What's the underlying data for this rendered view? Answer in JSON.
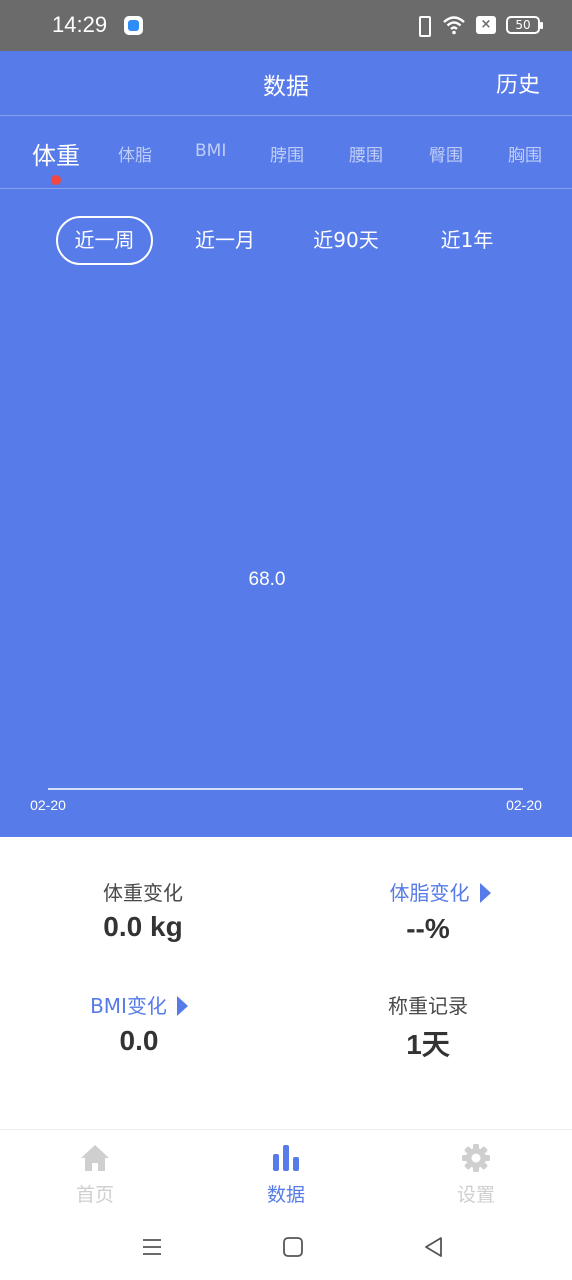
{
  "status_bar": {
    "time": "14:29",
    "battery": "50",
    "icons": [
      "app-icon",
      "vibrate-icon",
      "wifi-icon",
      "no-sim-icon",
      "battery-icon"
    ]
  },
  "header": {
    "title": "数据",
    "history_label": "历史"
  },
  "metric_tabs": [
    {
      "label": "体重",
      "active": true
    },
    {
      "label": "体脂",
      "active": false
    },
    {
      "label": "BMI",
      "active": false
    },
    {
      "label": "脖围",
      "active": false
    },
    {
      "label": "腰围",
      "active": false
    },
    {
      "label": "臀围",
      "active": false
    },
    {
      "label": "胸围",
      "active": false
    }
  ],
  "range_tabs": [
    {
      "label": "近一周",
      "active": true
    },
    {
      "label": "近一月",
      "active": false
    },
    {
      "label": "近90天",
      "active": false
    },
    {
      "label": "近1年",
      "active": false
    }
  ],
  "chart": {
    "point_value": "68.0",
    "x_start_label": "02-20",
    "x_end_label": "02-20"
  },
  "stats": {
    "weight_change": {
      "label": "体重变化",
      "value": "0.0 kg"
    },
    "fat_change": {
      "label": "体脂变化",
      "value": "--%"
    },
    "bmi_change": {
      "label": "BMI变化",
      "value": "0.0"
    },
    "weigh_record": {
      "label": "称重记录",
      "value": "1天"
    }
  },
  "bottom_nav": [
    {
      "label": "首页",
      "icon": "home-icon",
      "active": false
    },
    {
      "label": "数据",
      "icon": "bar-chart-icon",
      "active": true
    },
    {
      "label": "设置",
      "icon": "gear-icon",
      "active": false
    }
  ],
  "system_nav": [
    "menu-icon",
    "home-square-icon",
    "back-triangle-icon"
  ],
  "colors": {
    "primary": "#577be8",
    "status_bar": "#6b6b6b",
    "indicator_dot": "#f2463f",
    "inactive_nav": "#cfcfcf"
  }
}
